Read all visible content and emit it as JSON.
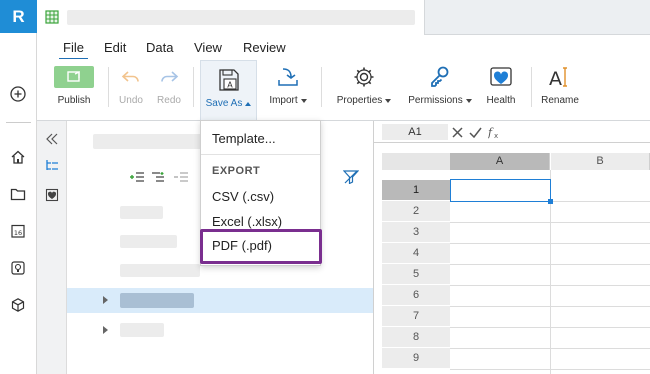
{
  "app": {
    "logo_letter": "R"
  },
  "menu": {
    "file": "File",
    "edit": "Edit",
    "data": "Data",
    "view": "View",
    "review": "Review"
  },
  "ribbon": {
    "publish": "Publish",
    "undo": "Undo",
    "redo": "Redo",
    "save_as": "Save As",
    "import": "Import",
    "properties": "Properties",
    "permissions": "Permissions",
    "health": "Health",
    "rename": "Rename"
  },
  "save_as_menu": {
    "template": "Template...",
    "export_header": "EXPORT",
    "csv": "CSV (.csv)",
    "excel": "Excel (.xlsx)",
    "pdf": "PDF (.pdf)"
  },
  "sheet": {
    "cell_ref": "A1",
    "columns": [
      "A",
      "B"
    ],
    "rows": [
      "1",
      "2",
      "3",
      "4",
      "5",
      "6",
      "7",
      "8",
      "9"
    ]
  },
  "colors": {
    "accent": "#1f8dd6",
    "highlight": "#7a2e8f",
    "selected_row": "#d9ebfa",
    "publish_green": "#8fd18f"
  }
}
